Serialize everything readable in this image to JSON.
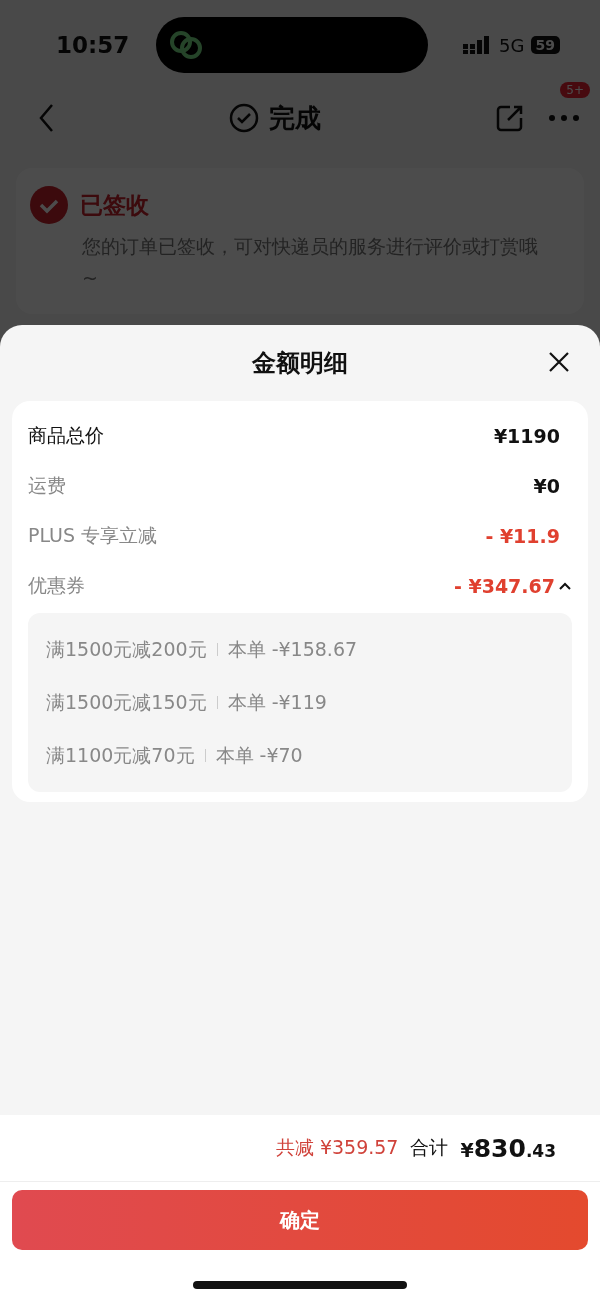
{
  "status_bar": {
    "time": "10:57",
    "network": "5G",
    "battery": "59"
  },
  "nav": {
    "title": "完成",
    "badge": "5+"
  },
  "tracking": {
    "status": "已签收",
    "message": "您的订单已签收，可对快递员的服务进行评价或打赏哦~"
  },
  "sheet": {
    "title": "金额明细",
    "rows": [
      {
        "label": "商品总价",
        "value": "¥1190",
        "kind": "total"
      },
      {
        "label": "运费",
        "value": "¥0",
        "kind": "normal"
      },
      {
        "label": "PLUS 专享立减",
        "value": "- ¥11.9",
        "kind": "discount"
      }
    ],
    "coupon": {
      "label": "优惠券",
      "value": "- ¥347.67",
      "expanded": true,
      "items": [
        {
          "rule": "满1500元减200元",
          "amount": "本单 -¥158.67"
        },
        {
          "rule": "满1500元减150元",
          "amount": "本单 -¥119"
        },
        {
          "rule": "满1100元减70元",
          "amount": "本单 -¥70"
        }
      ]
    }
  },
  "summary": {
    "saved": "共减 ¥359.57",
    "total_label": "合计",
    "currency": "¥",
    "total_int": "830",
    "total_dec": ".43"
  },
  "confirm_button": "确定"
}
